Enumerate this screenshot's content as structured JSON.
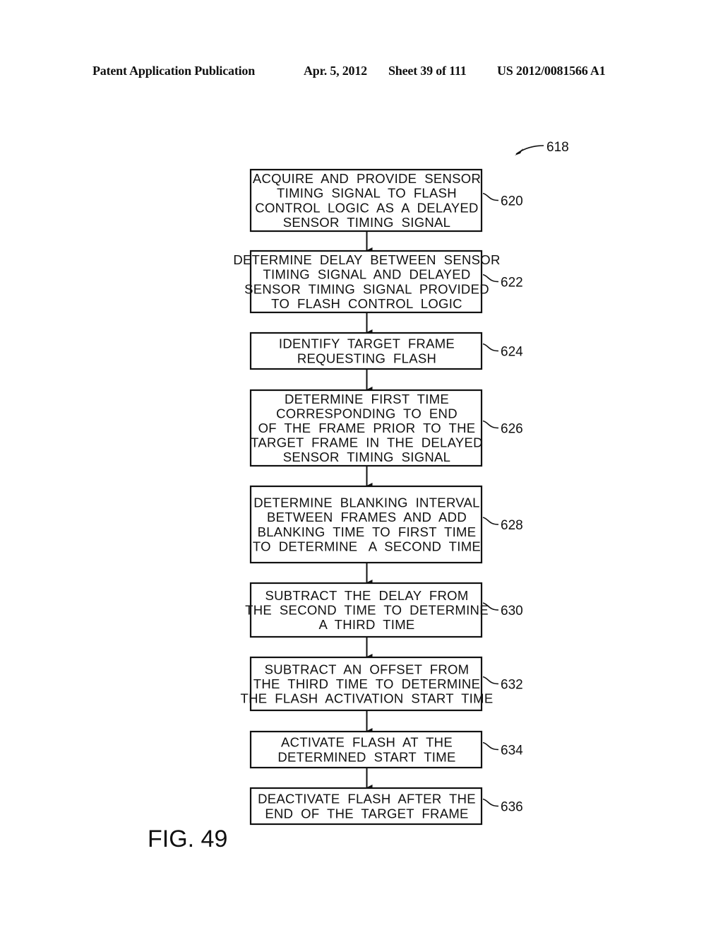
{
  "header": {
    "publication": "Patent Application Publication",
    "date": "Apr. 5, 2012",
    "sheet": "Sheet 39 of 111",
    "number": "US 2012/0081566 A1"
  },
  "figure": {
    "label": "FIG. 49",
    "reference": "618"
  },
  "steps": [
    {
      "ref": "620",
      "lines": [
        "ACQUIRE  AND  PROVIDE  SENSOR",
        "TIMING  SIGNAL  TO  FLASH",
        "CONTROL  LOGIC  AS  A  DELAYED",
        "SENSOR  TIMING  SIGNAL"
      ]
    },
    {
      "ref": "622",
      "lines": [
        "DETERMINE  DELAY  BETWEEN  SENSOR",
        "TIMING  SIGNAL  AND  DELAYED",
        "SENSOR  TIMING  SIGNAL  PROVIDED",
        "TO  FLASH  CONTROL  LOGIC"
      ]
    },
    {
      "ref": "624",
      "lines": [
        "IDENTIFY  TARGET  FRAME",
        "REQUESTING  FLASH"
      ]
    },
    {
      "ref": "626",
      "lines": [
        "DETERMINE  FIRST  TIME",
        "CORRESPONDING  TO  END",
        "OF  THE  FRAME  PRIOR  TO  THE",
        "TARGET  FRAME  IN  THE  DELAYED",
        "SENSOR  TIMING  SIGNAL"
      ]
    },
    {
      "ref": "628",
      "lines": [
        "DETERMINE  BLANKING  INTERVAL",
        "BETWEEN  FRAMES  AND  ADD",
        "BLANKING  TIME  TO  FIRST  TIME",
        "TO  DETERMINE   A  SECOND  TIME"
      ]
    },
    {
      "ref": "630",
      "lines": [
        "SUBTRACT  THE  DELAY  FROM",
        "THE  SECOND  TIME  TO  DETERMINE",
        "A  THIRD  TIME"
      ]
    },
    {
      "ref": "632",
      "lines": [
        "SUBTRACT  AN  OFFSET  FROM",
        "THE  THIRD  TIME  TO  DETERMINE",
        "THE  FLASH  ACTIVATION  START  TIME"
      ]
    },
    {
      "ref": "634",
      "lines": [
        "ACTIVATE  FLASH  AT  THE",
        "DETERMINED  START  TIME"
      ]
    },
    {
      "ref": "636",
      "lines": [
        "DEACTIVATE  FLASH  AFTER  THE",
        "END  OF  THE  TARGET  FRAME"
      ]
    }
  ]
}
